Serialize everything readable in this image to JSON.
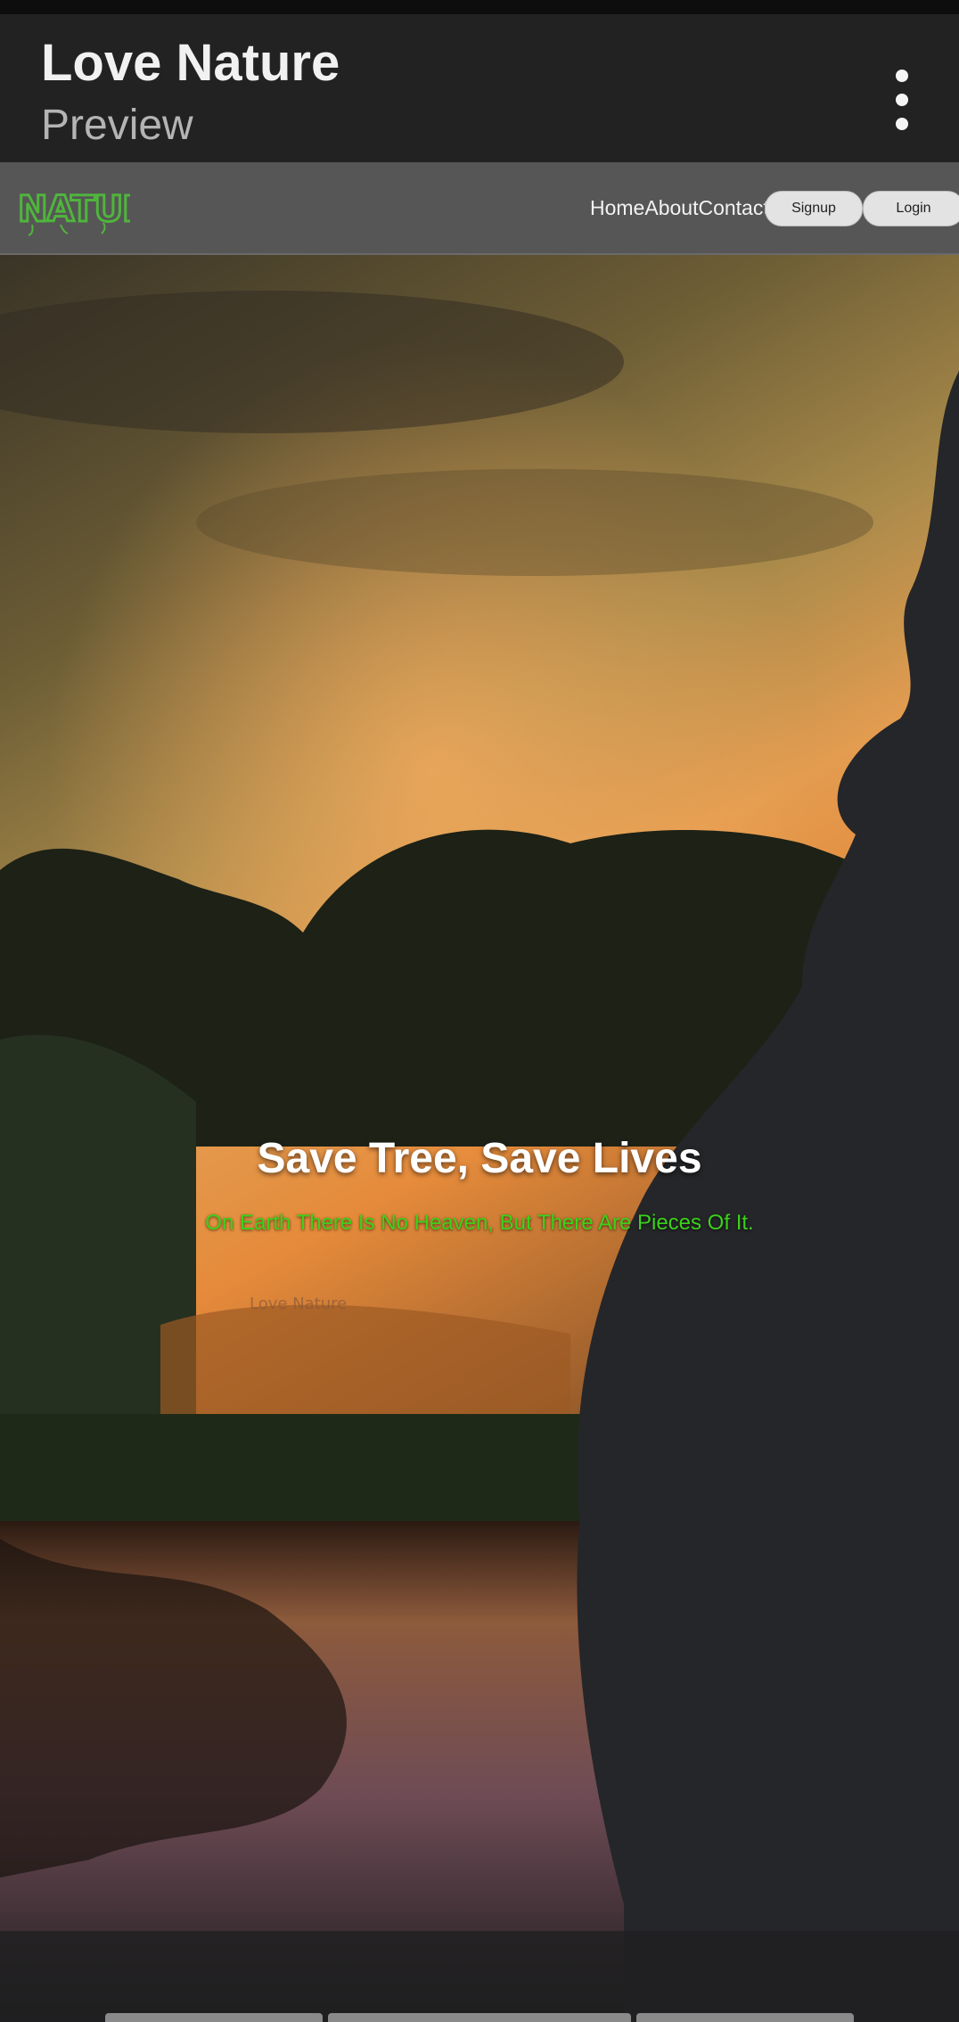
{
  "app_bar": {
    "title": "Love Nature",
    "subtitle": "Preview",
    "menu_icon": "more-vert-icon"
  },
  "site_nav": {
    "logo_text": "NATURE",
    "links": [
      "Home",
      "About",
      "Contact"
    ],
    "signup_label": "Signup",
    "login_label": "Login"
  },
  "hero": {
    "title": "Save Tree, Save Lives",
    "subtitle": "On Earth There Is No Heaven, But There Are Pieces Of It."
  },
  "colors": {
    "app_bar_bg": "#222222",
    "nav_bg": "#565656",
    "accent_green": "#3bd21a",
    "logo_green": "#4fb53c"
  }
}
